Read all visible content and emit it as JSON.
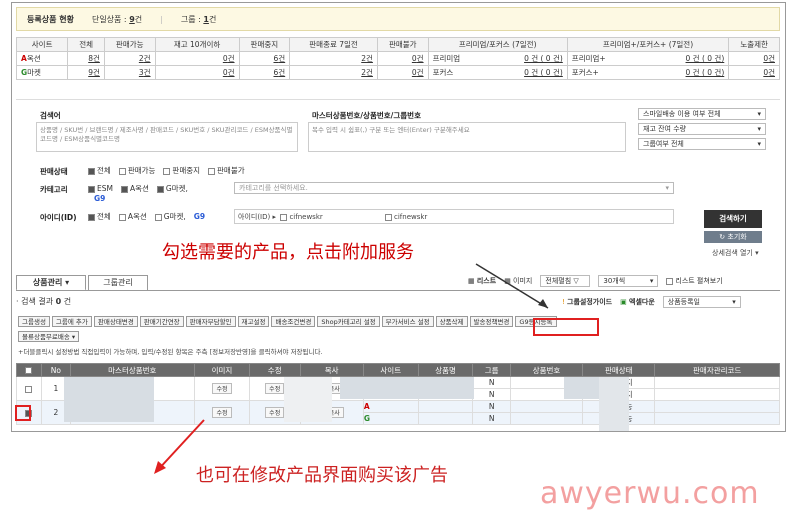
{
  "summary": {
    "title": "등록상품 현황",
    "single_label": "단일상품 :",
    "single_count": "9",
    "single_unit": "건",
    "group_label": "그룹 :",
    "group_count": "1",
    "group_unit": "건"
  },
  "stats": {
    "headers": [
      "사이트",
      "전체",
      "판매가능",
      "재고 10개이하",
      "판매중지",
      "판매종료 7일전",
      "판매불가",
      "프리미엄/포커스 (7일전)",
      "프리미엄+/포커스+ (7일전)",
      "노출제한"
    ],
    "rows": [
      {
        "site_letter": "A",
        "site_rest": "옥션",
        "total": "8",
        "sellable": "2",
        "stock": "0",
        "stopped": "6",
        "ending": "2",
        "unsellable": "0",
        "prem_label": "프리미엄",
        "prem_val": "0 건 ( 0 건)",
        "premplus_label": "프리미엄+",
        "premplus_val": "0 건 ( 0 건)",
        "limit": "0"
      },
      {
        "site_letter": "G",
        "site_rest": "마켓",
        "total": "9",
        "sellable": "3",
        "stock": "0",
        "stopped": "6",
        "ending": "2",
        "unsellable": "0",
        "prem_label": "포커스",
        "prem_val": "0 건 ( 0 건)",
        "premplus_label": "포커스+",
        "premplus_val": "0 건 ( 0 건)",
        "limit": "0"
      }
    ],
    "unit": "건"
  },
  "search": {
    "keyword_label": "검색어",
    "keyword_hint": "상품명 / SKU번 / 브랜드명 / 제조사명 / 판매코드 / SKU번호 / SKU관리코드 / ESM상품식별코드명 / ESM상품식별코드명",
    "master_label": "마스터상품번호/상품번호/그룹번호",
    "master_hint": "복수 입력 시 쉼표(,) 구분 또는 엔터(Enter) 구분해주세요",
    "dropdowns": [
      "스마일배송 이용 여부 전체",
      "재고 잔여 수량",
      "그룹여부 전체"
    ],
    "status_label": "판매상태",
    "status_options": [
      "전체",
      "판매가능",
      "판매중지",
      "판매불가"
    ],
    "category_label": "카테고리",
    "category_options": [
      "ESM",
      "A옥션",
      "G마켓,"
    ],
    "category_g9": "G9",
    "category_placeholder": "카테고리를 선택하세요.",
    "id_label": "아이디(ID)",
    "id_options": [
      "전체",
      "A옥션",
      "G마켓,"
    ],
    "id_g9": "G9",
    "id_select": "아이디(ID)",
    "id_value_1": "cifnewskr",
    "id_value_2": "cifnewskr",
    "search_button": "검색하기",
    "reset_button": "초기화",
    "detail_toggle": "상세검색 열기"
  },
  "annotation_top": "勾选需要的产品，点击附加服务",
  "annotation_bottom": "也可在修改产品界面购买该广告",
  "watermark": "awyerwu.com",
  "tabs": {
    "manage": "상품관리",
    "group": "그룹관리"
  },
  "view": {
    "list": "리스트",
    "image": "이미지",
    "expand": "전체펼침 ▽",
    "per_page": "30개씩",
    "group_expand": "리스트 펼쳐보기"
  },
  "result": {
    "label": "검색 결과",
    "count": "0",
    "unit": "건"
  },
  "group_guide": "그룹설정가이드",
  "excel": "엑셀다운",
  "sort": "상품등록일",
  "toolbar": [
    "그룹생성",
    "그룹에 추가",
    "판매상태변경",
    "판매기간연장",
    "판매자부담할인",
    "재고설정",
    "배송조건변경",
    "Shop카테고리 설정",
    "부가서비스 설정",
    "상품삭제",
    "발송정책변경",
    "G9등시등록"
  ],
  "toolbar2": "몰류상품무료배송",
  "hint_line": "+더블클릭시  설정방법  직접입력이 가능하며, 입력/수정된 항목은 주측 [정보저장반영]을 클릭하셔야 저장됩니다.",
  "list": {
    "headers": [
      "No",
      "마스터상품번호",
      "이미지",
      "수정",
      "복사",
      "사이트",
      "상품명",
      "그룹",
      "상품번호",
      "판매상태",
      "판매자관리코드"
    ],
    "rows": [
      {
        "no": "1",
        "edit": "수정",
        "copy": "복사",
        "group_a": "N",
        "group_g": "N",
        "status_a": "판매중지",
        "status_g": "판매중지",
        "checked": false
      },
      {
        "no": "2",
        "edit": "수정",
        "copy": "복사",
        "group_a": "N",
        "group_g": "N",
        "status_a": "판매가능",
        "status_g": "판매가능",
        "checked": true
      }
    ]
  }
}
